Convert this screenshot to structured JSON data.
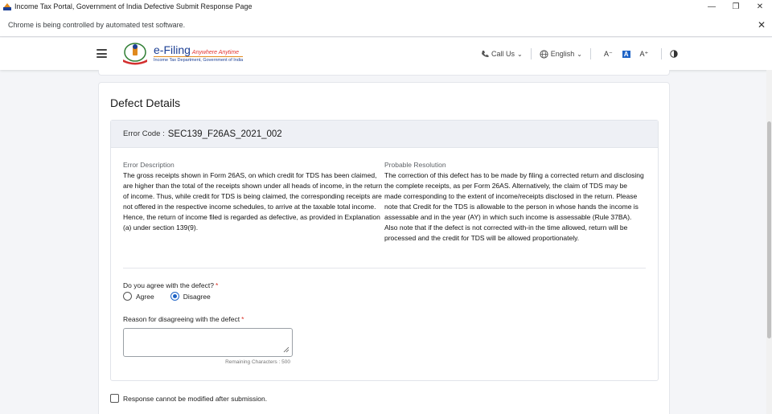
{
  "window": {
    "title": "Income Tax Portal, Government of India Defective Submit Response Page",
    "minimize": "—",
    "maximize": "❐",
    "close": "✕"
  },
  "infobar": {
    "text": "Chrome is being controlled by automated test software.",
    "close": "✕"
  },
  "header": {
    "logo_title": "e-Filing",
    "logo_tagline": "Anywhere Anytime",
    "logo_subtitle": "Income Tax Department, Government of India",
    "call_us": "Call Us",
    "language": "English",
    "font_decrease": "A⁻",
    "font_normal": "A",
    "font_increase": "A⁺"
  },
  "defect": {
    "title": "Defect Details",
    "error_code_label": "Error Code :",
    "error_code": "SEC139_F26AS_2021_002",
    "description_label": "Error Description",
    "description": "The gross receipts shown in Form 26AS, on which credit for TDS has been claimed, are higher than the total of the receipts shown under all heads of income, in the return of income. Thus, while credit for TDS is being claimed, the corresponding receipts are not offered in the respective income schedules, to arrive at the taxable total income. Hence, the return of income filed is regarded as defective, as provided in Explanation (a) under section 139(9).",
    "resolution_label": "Probable Resolution",
    "resolution": "The correction of this defect has to be made by filing a corrected return and disclosing the complete receipts, as per Form 26AS. Alternatively, the claim of TDS may be made corresponding to the extent of income/receipts disclosed in the return. Please note that Credit for the TDS is allowable to the person in whose hands the income is assessable and in the year (AY) in which such income is assessable (Rule 37BA). Also note that if the defect is not corrected with-in the time allowed, return will be processed and the credit for TDS will be allowed proportionately."
  },
  "form": {
    "agree_question": "Do you agree with the defect?",
    "required_mark": "*",
    "options": [
      "Agree",
      "Disagree"
    ],
    "selected": "Disagree",
    "reason_label": "Reason for disagreeing with the defect",
    "reason_value": "",
    "remaining_label": "Remaining Characters : 500",
    "submit_note": "Response cannot be modified after submission."
  },
  "colors": {
    "accent": "#1e63c6",
    "required": "#d93025",
    "brand": "#1c3f94"
  }
}
